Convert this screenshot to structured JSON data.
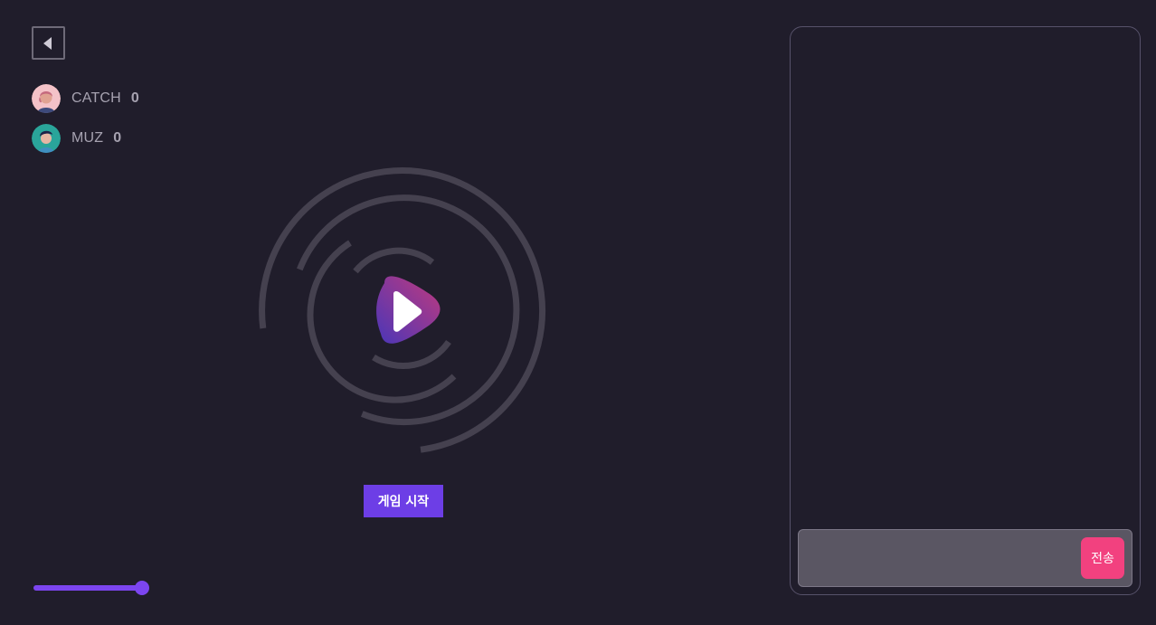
{
  "players": [
    {
      "name": "CATCH",
      "score": "0",
      "avatar_color": "#f4c2c8"
    },
    {
      "name": "MUZ",
      "score": "0",
      "avatar_color": "#2aa59a"
    }
  ],
  "game": {
    "start_label": "게임 시작",
    "play_icon": "play-icon"
  },
  "volume": {
    "level": 1.0
  },
  "chat": {
    "input_value": "",
    "send_label": "전송"
  },
  "colors": {
    "background": "#201d2b",
    "accent": "#6d3ee6",
    "send": "#f2417f",
    "ring": "#45414f"
  }
}
